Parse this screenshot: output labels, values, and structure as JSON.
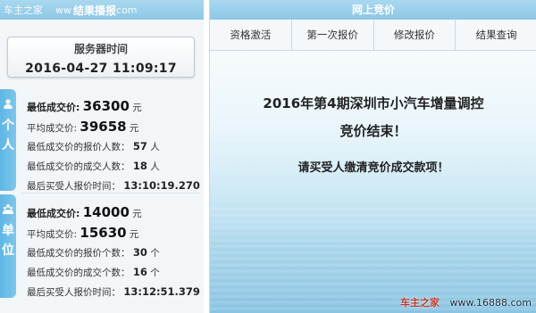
{
  "left_header": {
    "brand": "车主之家",
    "ww": "ww",
    "title": "结果播报",
    "com": "com"
  },
  "server_time": {
    "label": "服务器时间",
    "value": "2016-04-27 11:09:17"
  },
  "person": {
    "tab_label_1": "个",
    "tab_label_2": "人",
    "lowest_label": "最低成交价:",
    "lowest_value": "36300",
    "lowest_unit": "元",
    "avg_label": "平均成交价:",
    "avg_value": "39658",
    "avg_unit": "元",
    "bidders_label": "最低成交价的报价人数：",
    "bidders_value": "57",
    "bidders_unit": "人",
    "winners_label": "最低成交价的成交人数：",
    "winners_value": "18",
    "winners_unit": "人",
    "last_time_label": "最后买受人报价时间：",
    "last_time_value": "13:10:19.270"
  },
  "unit": {
    "tab_label_1": "单",
    "tab_label_2": "位",
    "lowest_label": "最低成交价:",
    "lowest_value": "14000",
    "lowest_unit": "元",
    "avg_label": "平均成交价:",
    "avg_value": "15630",
    "avg_unit": "元",
    "bidders_label": "最低成交价的报价个数：",
    "bidders_value": "30",
    "bidders_unit": "个",
    "winners_label": "最低成交价的成交个数：",
    "winners_value": "16",
    "winners_unit": "个",
    "last_time_label": "最后买受人报价时间：",
    "last_time_value": "13:12:51.379"
  },
  "right_header": {
    "title": "网上竞价"
  },
  "tabs": [
    {
      "label": "资格激活"
    },
    {
      "label": "第一次报价"
    },
    {
      "label": "修改报价"
    },
    {
      "label": "结果查询"
    }
  ],
  "message": {
    "line1": "2016年第4期深圳市小汽车增量调控",
    "line2": "竞价结束！",
    "line3": "请买受人缴清竞价成交款项！"
  },
  "watermark": {
    "name": "车主之家",
    "url": "www.16888.com"
  }
}
